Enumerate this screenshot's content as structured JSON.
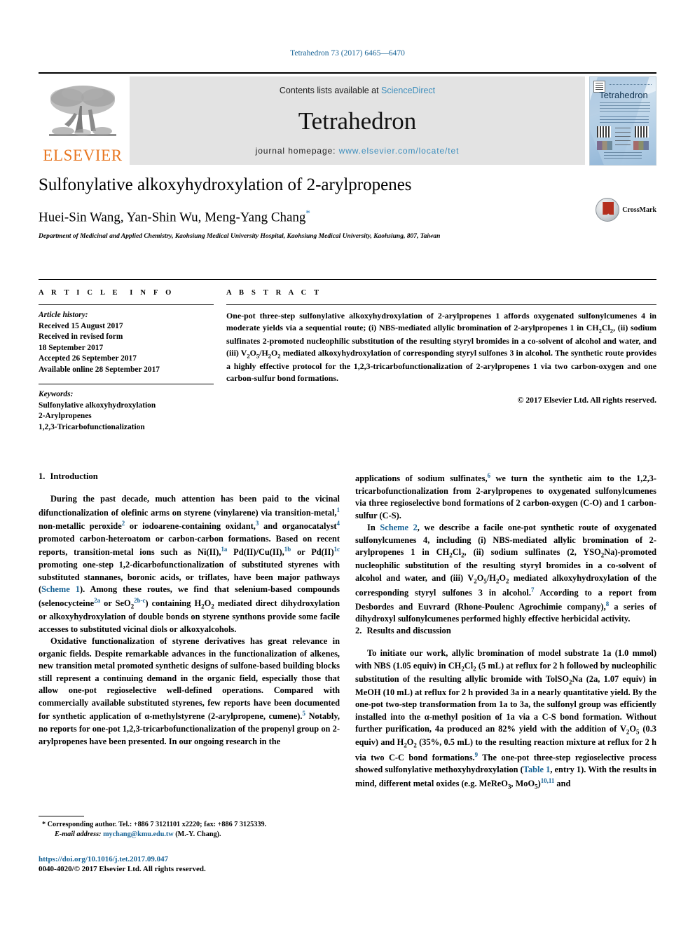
{
  "running_head": "Tetrahedron 73 (2017) 6465—6470",
  "masthead": {
    "publisher_logo_name": "elsevier-tree-logo",
    "publisher_wordmark": "ELSEVIER",
    "contents_prefix": "Contents lists available at ",
    "contents_link": "ScienceDirect",
    "journal_name": "Tetrahedron",
    "homepage_prefix": "journal homepage: ",
    "homepage_url": "www.elsevier.com/locate/tet",
    "cover_title": "Tetrahedron",
    "band_color": "#e3e3e3",
    "link_color": "#3c8dbc",
    "elsevier_orange": "#E87722"
  },
  "article": {
    "title": "Sulfonylative alkoxyhydroxylation of 2-arylpropenes",
    "authors": "Huei-Sin Wang, Yan-Shin Wu, Meng-Yang Chang",
    "corresponding_marker": "*",
    "affiliation": "Department of Medicinal and Applied Chemistry, Kaohsiung Medical University Hospital, Kaohsiung Medical University, Kaohsiung, 807, Taiwan",
    "crossmark_label": "CrossMark"
  },
  "article_info": {
    "heading": "ARTICLE INFO",
    "history_label": "Article history:",
    "history": [
      "Received 15 August 2017",
      "Received in revised form",
      "18 September 2017",
      "Accepted 26 September 2017",
      "Available online 28 September 2017"
    ],
    "keywords_label": "Keywords:",
    "keywords": [
      "Sulfonylative alkoxyhydroxylation",
      "2-Arylpropenes",
      "1,2,3-Tricarbofunctionalization"
    ]
  },
  "abstract": {
    "heading": "ABSTRACT",
    "copyright": "© 2017 Elsevier Ltd. All rights reserved."
  },
  "sections": {
    "intro_number": "1.",
    "intro_title": "Introduction",
    "results_number": "2.",
    "results_title": "Results and discussion"
  },
  "footnotes": {
    "corresponding": "Corresponding author. Tel.: +886 7 3121101 x2220; fax: +886 7 3125339.",
    "email_label": "E-mail address:",
    "email": "mychang@kmu.edu.tw",
    "email_suffix": "(M.-Y. Chang).",
    "doi": "https://doi.org/10.1016/j.tet.2017.09.047",
    "issn_line": "0040-4020/© 2017 Elsevier Ltd. All rights reserved."
  }
}
